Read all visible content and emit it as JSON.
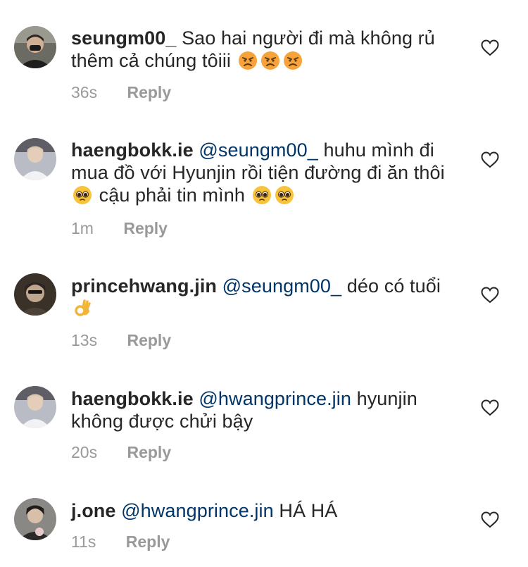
{
  "comments": [
    {
      "username": "seungm00_",
      "mention": "",
      "text": "Sao hai người đi mà không rủ thêm cả chúng tôiii",
      "emojis": [
        "angry-face",
        "angry-face",
        "angry-face"
      ],
      "time": "36s",
      "reply_label": "Reply"
    },
    {
      "username": "haengbokk.ie",
      "mention": "@seungm00_",
      "text": "huhu mình đi mua đồ với Hyunjin rồi tiện đường đi ăn thôi",
      "text2": "cậu phải tin mình",
      "emojis": [
        "pleading-face",
        "pleading-face",
        "pleading-face"
      ],
      "time": "1m",
      "reply_label": "Reply"
    },
    {
      "username": "princehwang.jin",
      "mention": "@seungm00_",
      "text": "déo có tuổi",
      "emojis": [
        "ok-hand"
      ],
      "time": "13s",
      "reply_label": "Reply"
    },
    {
      "username": "haengbokk.ie",
      "mention": "@hwangprince.jin",
      "text": "hyunjin không được chửi bậy",
      "emojis": [],
      "time": "20s",
      "reply_label": "Reply"
    },
    {
      "username": "j.one",
      "mention": "@hwangprince.jin",
      "text": "HÁ HÁ",
      "emojis": [],
      "time": "11s",
      "reply_label": "Reply"
    }
  ],
  "icons": {
    "like": "heart-outline-icon"
  },
  "colors": {
    "username": "#262626",
    "mention": "#003569",
    "meta": "#999999",
    "emoji_yellow": "#F7C33A"
  }
}
